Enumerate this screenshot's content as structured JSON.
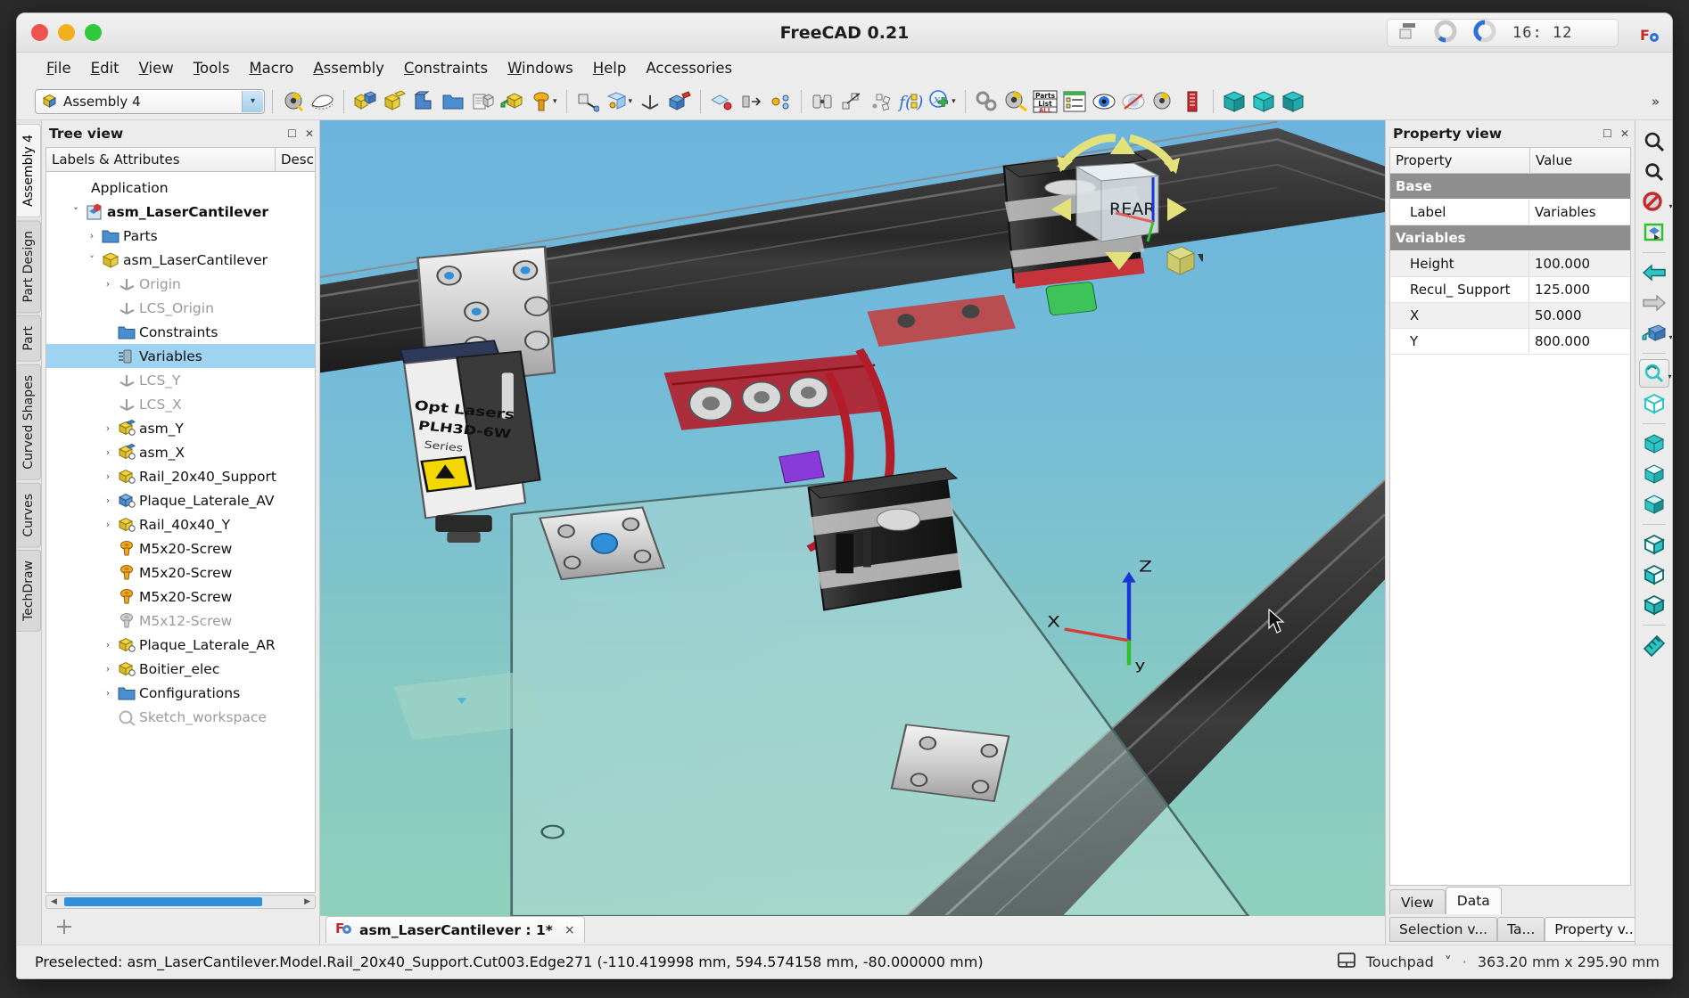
{
  "window": {
    "title": "FreeCAD 0.21",
    "traffic": [
      "close",
      "minimize",
      "maximize"
    ]
  },
  "tray": {
    "clock": "16: 12",
    "icons": [
      "windows-icon",
      "donut-chart-icon",
      "donut-chart-filled-icon",
      "freecad-icon"
    ]
  },
  "menubar": {
    "items": [
      {
        "label": "File",
        "mnemonic": "F"
      },
      {
        "label": "Edit",
        "mnemonic": "E"
      },
      {
        "label": "View",
        "mnemonic": "V"
      },
      {
        "label": "Tools",
        "mnemonic": "T"
      },
      {
        "label": "Macro",
        "mnemonic": "M"
      },
      {
        "label": "Assembly",
        "mnemonic": "A"
      },
      {
        "label": "Constraints",
        "mnemonic": "C"
      },
      {
        "label": "Windows",
        "mnemonic": "W"
      },
      {
        "label": "Help",
        "mnemonic": "H"
      },
      {
        "label": "Accessories",
        "mnemonic": ""
      }
    ]
  },
  "toolbar": {
    "workbench_selected": "Assembly 4",
    "overflow_label": "»",
    "icons": [
      "measure-icon",
      "spline-surface-icon",
      "insert-part-icon",
      "new-part-icon",
      "new-body-icon",
      "open-folder-icon",
      "import-part-icon",
      "link-part-icon",
      "fastener-icon",
      "fastener-dropdown-caret",
      "placement-icon",
      "attachment-icon",
      "attachment-caret",
      "lcs-icon",
      "group-icon",
      "constraint-plane-icon",
      "constraint-axis-icon",
      "constraint-point-icon",
      "solve-icon",
      "mirror-icon",
      "array-icon",
      "sketch-relations-icon",
      "expression-icon",
      "variable-add-icon",
      "variable-caret",
      "gears-icon",
      "measure-tape-icon",
      "parts-list-icon",
      "tree-list-icon",
      "eye-icon",
      "hide-icon",
      "material-icon",
      "display-mode-icon",
      "view-front-icon",
      "view-top-icon",
      "view-iso-icon"
    ]
  },
  "workbench_tabs": {
    "items": [
      "Assembly 4",
      "Part Design",
      "Part",
      "Curved Shapes",
      "Curves",
      "TechDraw"
    ],
    "active": "Assembly 4"
  },
  "tree_panel": {
    "title": "Tree view",
    "columns": [
      "Labels & Attributes",
      "Desc"
    ],
    "nodes": [
      {
        "label": "Application",
        "indent": 0,
        "twisty": "",
        "icon": "",
        "state": "normal"
      },
      {
        "label": "asm_LaserCantilever",
        "indent": 1,
        "twisty": "open",
        "icon": "document-icon",
        "state": "bold"
      },
      {
        "label": "Parts",
        "indent": 2,
        "twisty": "closed",
        "icon": "folder-icon",
        "state": "normal"
      },
      {
        "label": "asm_LaserCantilever",
        "indent": 2,
        "twisty": "open",
        "icon": "part-icon",
        "state": "normal"
      },
      {
        "label": "Origin",
        "indent": 3,
        "twisty": "closed",
        "icon": "lcs-icon",
        "state": "dim"
      },
      {
        "label": "LCS_Origin",
        "indent": 3,
        "twisty": "",
        "icon": "lcs-icon",
        "state": "dim"
      },
      {
        "label": "Constraints",
        "indent": 3,
        "twisty": "",
        "icon": "folder-icon",
        "state": "normal"
      },
      {
        "label": "Variables",
        "indent": 3,
        "twisty": "",
        "icon": "variables-icon",
        "state": "selected"
      },
      {
        "label": "LCS_Y",
        "indent": 3,
        "twisty": "",
        "icon": "lcs-icon",
        "state": "dim"
      },
      {
        "label": "LCS_X",
        "indent": 3,
        "twisty": "",
        "icon": "lcs-icon",
        "state": "dim"
      },
      {
        "label": "asm_Y",
        "indent": 3,
        "twisty": "closed",
        "icon": "link-assembly-icon",
        "state": "normal"
      },
      {
        "label": "asm_X",
        "indent": 3,
        "twisty": "closed",
        "icon": "link-assembly-icon",
        "state": "normal"
      },
      {
        "label": "Rail_20x40_Support",
        "indent": 3,
        "twisty": "closed",
        "icon": "link-part-icon",
        "state": "normal"
      },
      {
        "label": "Plaque_Laterale_AV",
        "indent": 3,
        "twisty": "closed",
        "icon": "link-part-blue-icon",
        "state": "normal"
      },
      {
        "label": "Rail_40x40_Y",
        "indent": 3,
        "twisty": "closed",
        "icon": "link-part-icon",
        "state": "normal"
      },
      {
        "label": "M5x20-Screw",
        "indent": 3,
        "twisty": "",
        "icon": "screw-icon",
        "state": "normal"
      },
      {
        "label": "M5x20-Screw",
        "indent": 3,
        "twisty": "",
        "icon": "screw-icon",
        "state": "normal"
      },
      {
        "label": "M5x20-Screw",
        "indent": 3,
        "twisty": "",
        "icon": "screw-icon",
        "state": "normal"
      },
      {
        "label": "M5x12-Screw",
        "indent": 3,
        "twisty": "",
        "icon": "screw-grey-icon",
        "state": "dim"
      },
      {
        "label": "Plaque_Laterale_AR",
        "indent": 3,
        "twisty": "closed",
        "icon": "link-part-icon",
        "state": "normal"
      },
      {
        "label": "Boitier_elec",
        "indent": 3,
        "twisty": "closed",
        "icon": "link-part-icon",
        "state": "normal"
      },
      {
        "label": "Configurations",
        "indent": 3,
        "twisty": "closed",
        "icon": "folder-icon",
        "state": "normal"
      },
      {
        "label": "Sketch_workspace",
        "indent": 3,
        "twisty": "",
        "icon": "sketch-icon",
        "state": "dim"
      }
    ]
  },
  "property_panel": {
    "title": "Property view",
    "columns": [
      "Property",
      "Value"
    ],
    "groups": [
      {
        "name": "Base",
        "rows": [
          {
            "name": "Label",
            "value": "Variables"
          }
        ]
      },
      {
        "name": "Variables",
        "rows": [
          {
            "name": "Height",
            "value": "100.000"
          },
          {
            "name": "Recul_ Support",
            "value": "125.000"
          },
          {
            "name": "X",
            "value": "50.000"
          },
          {
            "name": "Y",
            "value": "800.000"
          }
        ]
      }
    ],
    "view_data_tabs": {
      "items": [
        "View",
        "Data"
      ],
      "active": "Data"
    },
    "dock_tabs": {
      "items": [
        "Selection v...",
        "Ta...",
        "Property v..."
      ],
      "active": "Property v..."
    }
  },
  "document_tab": {
    "label": "asm_LaserCantilever : 1*",
    "close": "×"
  },
  "viewport": {
    "navcube_label": "REAR",
    "axis_labels": {
      "x": "X",
      "y": "y",
      "z": "Z"
    }
  },
  "right_toolbar": {
    "icons": [
      "zoom-fit-icon",
      "zoom-selection-icon",
      "no-draw-style-icon",
      "draw-style-caret",
      "box-selection-icon",
      "back-arrow-icon",
      "forward-arrow-icon",
      "part-view-icon",
      "part-view-caret",
      "refresh-view-icon",
      "refresh-caret",
      "axonometric-icon",
      "front-view-icon",
      "top-view-icon",
      "right-view-icon",
      "rear-view-icon",
      "bottom-view-icon",
      "left-view-icon",
      "measure-ruler-icon"
    ]
  },
  "statusbar": {
    "message": "Preselected: asm_LaserCantilever.Model.Rail_20x40_Support.Cut003.Edge271 (-110.419998 mm, 594.574158 mm, -80.000000 mm)",
    "nav_style": "Touchpad",
    "nav_caret": "˅",
    "separator": "·",
    "dimensions": "363.20 mm x 295.90 mm"
  },
  "colors": {
    "selection_blue": "#9fd3f2",
    "group_header_grey": "#8e8e8e",
    "scroll_thumb": "#2f8fd8",
    "sky_top": "#6cb4dd",
    "sky_bottom": "#8fd0bd",
    "nav_yellow": "#e3e27a",
    "axis_blue": "#1a35d8",
    "axis_red": "#d83a3a",
    "axis_green": "#2fc02f"
  }
}
